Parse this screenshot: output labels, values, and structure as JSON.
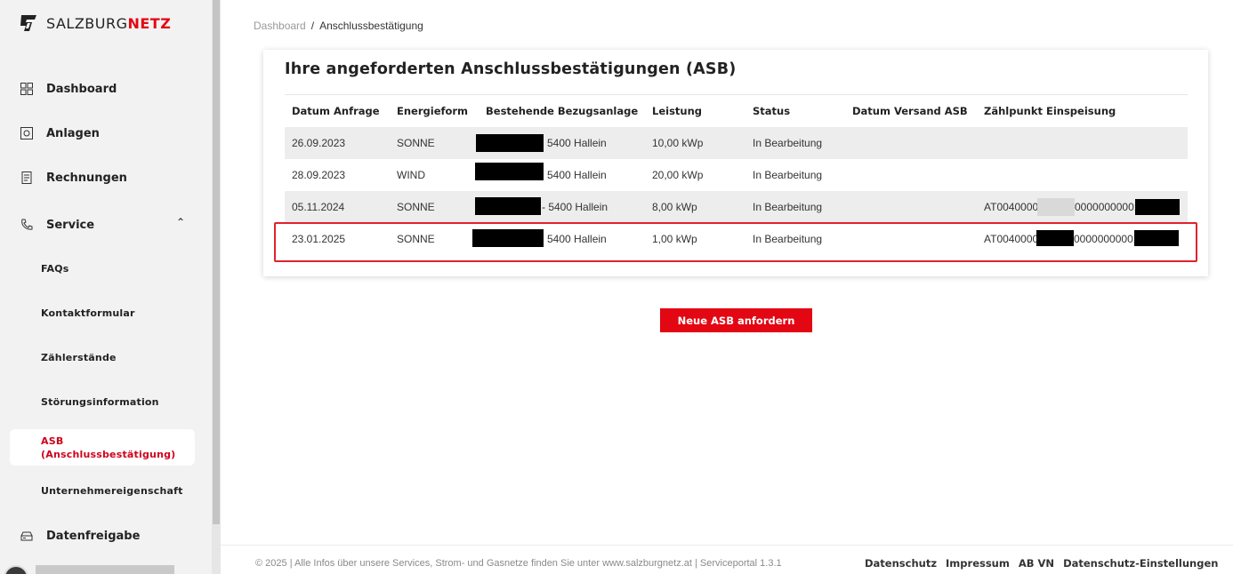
{
  "brand": {
    "prefix": "SALZBURG",
    "suffix": "NETZ",
    "accent": "#e30613"
  },
  "sidebar": {
    "items": [
      {
        "label": "Dashboard",
        "icon": "grid-icon"
      },
      {
        "label": "Anlagen",
        "icon": "meter-icon"
      },
      {
        "label": "Rechnungen",
        "icon": "invoice-icon"
      },
      {
        "label": "Service",
        "icon": "phone-icon"
      },
      {
        "label": "Datenfreigabe",
        "icon": "data-icon"
      }
    ],
    "service_sub": [
      {
        "label": "FAQs"
      },
      {
        "label": "Kontaktformular"
      },
      {
        "label": "Zählerstände"
      },
      {
        "label": "Störungsinformation"
      },
      {
        "label": "ASB\n(Anschlussbestätigung)"
      },
      {
        "label": "Unternehmereigenschaft"
      }
    ]
  },
  "breadcrumb": {
    "root": "Dashboard",
    "separator": "/",
    "current": "Anschlussbestätigung"
  },
  "card": {
    "title": "Ihre angeforderten Anschlussbestätigungen (ASB)",
    "columns": [
      "Datum Anfrage",
      "Energieform",
      "Bestehende Bezugsanlage",
      "Leistung",
      "Status",
      "Datum Versand ASB",
      "Zählpunkt Einspeisung"
    ],
    "rows": [
      {
        "date": "26.09.2023",
        "energy": "SONNE",
        "address": "5400 Hallein",
        "power": "10,00 kWp",
        "status": "In Bearbeitung",
        "sent": "",
        "zp_prefix": "",
        "zp_suffix": ""
      },
      {
        "date": "28.09.2023",
        "energy": "WIND",
        "address": "5400 Hallein",
        "power": "20,00 kWp",
        "status": "In Bearbeitung",
        "sent": "",
        "zp_prefix": "",
        "zp_suffix": ""
      },
      {
        "date": "05.11.2024",
        "energy": "SONNE",
        "address": "- 5400 Hallein",
        "power": "8,00 kWp",
        "status": "In Bearbeitung",
        "sent": "",
        "zp_prefix": "AT0040000",
        "zp_suffix": "00000000001"
      },
      {
        "date": "23.01.2025",
        "energy": "SONNE",
        "address": "5400 Hallein",
        "power": "1,00 kWp",
        "status": "In Bearbeitung",
        "sent": "",
        "zp_prefix": "AT0040000",
        "zp_suffix": "00000000001"
      }
    ]
  },
  "cta": {
    "label": "Neue ASB anfordern"
  },
  "footer": {
    "text": "© 2025 | Alle Infos über unsere Services, Strom- und Gasnetze finden Sie unter www.salzburgnetz.at | Serviceportal 1.3.1",
    "links": [
      "Datenschutz",
      "Impressum",
      "AB VN",
      "Datenschutz-Einstellungen"
    ]
  }
}
